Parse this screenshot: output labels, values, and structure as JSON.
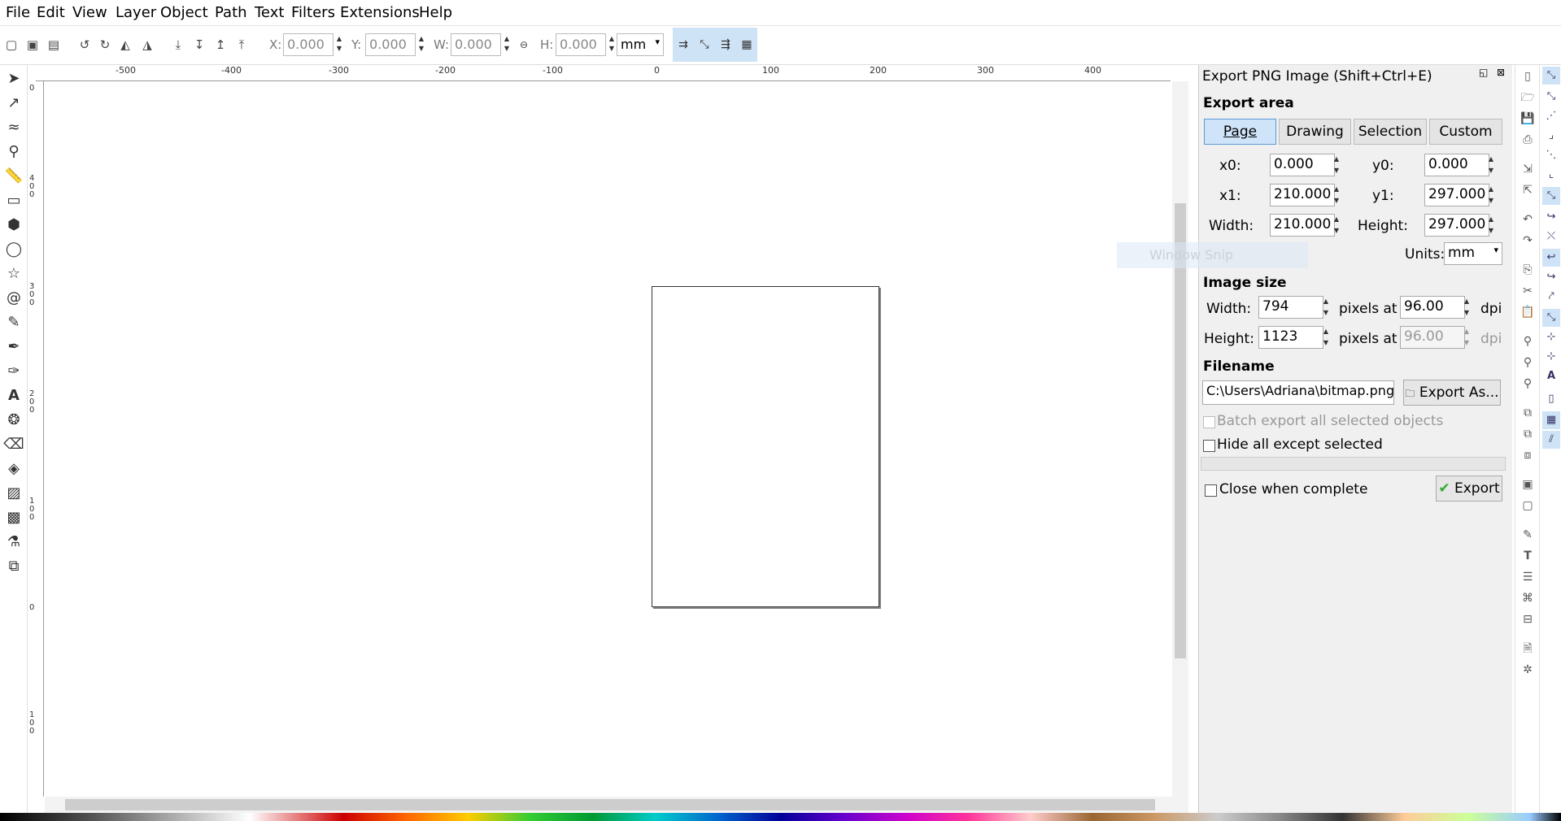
{
  "menu": [
    "File",
    "Edit",
    "View",
    "Layer",
    "Object",
    "Path",
    "Text",
    "Filters",
    "Extensions",
    "Help"
  ],
  "toolbar": {
    "x_label": "X:",
    "x_value": "0.000",
    "y_label": "Y:",
    "y_value": "0.000",
    "w_label": "W:",
    "w_value": "0.000",
    "h_label": "H:",
    "h_value": "0.000",
    "unit": "mm"
  },
  "ruler": {
    "h_labels": [
      "-500",
      "-400",
      "-300",
      "-200",
      "-100",
      "0",
      "100",
      "200",
      "300",
      "400"
    ],
    "v_labels": [
      "0",
      "400",
      "300",
      "200",
      "100",
      "0",
      "100"
    ]
  },
  "panel": {
    "title": "Export PNG Image (Shift+Ctrl+E)",
    "export_area_heading": "Export area",
    "tabs": [
      "Page",
      "Drawing",
      "Selection",
      "Custom"
    ],
    "x0_label": "x0:",
    "x0": "0.000",
    "y0_label": "y0:",
    "y0": "0.000",
    "x1_label": "x1:",
    "x1": "210.000",
    "y1_label": "y1:",
    "y1": "297.000",
    "width_label": "Width:",
    "width": "210.000",
    "height_label": "Height:",
    "height": "297.000",
    "units_label": "Units:",
    "units": "mm",
    "image_size_heading": "Image size",
    "img_width_label": "Width:",
    "img_width": "794",
    "img_height_label": "Height:",
    "img_height": "1123",
    "pixels_at": "pixels at",
    "dpi_x": "96.00",
    "dpi_y": "96.00",
    "dpi_label": "dpi",
    "filename_heading": "Filename",
    "filename": "C:\\Users\\Adriana\\bitmap.png",
    "export_as_label": "Export As...",
    "batch_label": "Batch export all selected objects",
    "hide_label": "Hide all except selected",
    "close_label": "Close when complete",
    "export_label": "Export"
  },
  "ghost_text": "Window Snip"
}
